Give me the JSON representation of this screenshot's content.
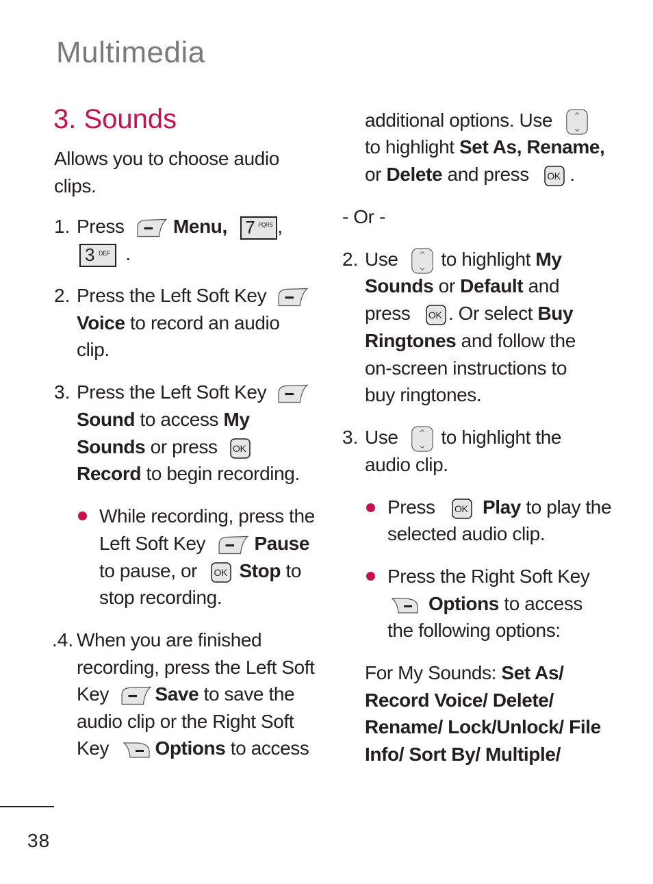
{
  "header": {
    "chapter_title": "Multimedia",
    "section_title": "3. Sounds"
  },
  "intro": [
    "Allows you to choose audio",
    "clips."
  ],
  "left_column": {
    "step1": {
      "num": "1.",
      "press": "Press",
      "menu": "Menu,",
      "comma": ",",
      "period": "."
    },
    "step2": {
      "num": "2.",
      "l1": "Press the Left Soft Key",
      "voice": "Voice",
      "l2rest": " to record an audio",
      "l3": "clip."
    },
    "step3": {
      "num": "3.",
      "l1": "Press the Left Soft Key",
      "sound": "Sound",
      "toaccess": " to access ",
      "my": "My",
      "sounds": "Sounds",
      "orpress": " or press",
      "record": "Record",
      "tobegin": " to begin recording."
    },
    "bullet1": {
      "l1": "While recording, press the",
      "l2a": "Left Soft Key",
      "pause": "Pause",
      "l3a": "to pause, or",
      "stop": "Stop",
      "l3b": " to",
      "l4": "stop recording."
    },
    "step4": {
      "num": ".4.",
      "l1": "When you are finished",
      "l2": "recording, press the Left Soft",
      "key": "Key",
      "save": "Save",
      "tosave": " to save the",
      "l4": "audio clip or the Right Soft",
      "options": "Options",
      "toaccess": " to access"
    }
  },
  "right_column": {
    "cont": {
      "l1": "additional options. Use",
      "l2a": "to highlight ",
      "l2b": "Set As, Rename,",
      "or": "or ",
      "delete": "Delete",
      "andpress": " and press",
      "period": "."
    },
    "or_sep": "- Or -",
    "step2": {
      "num": "2.",
      "use": "Use",
      "tohighlight": " to highlight ",
      "my": "My",
      "sounds": "Sounds",
      "or": " or ",
      "default": "Default",
      "and": " and",
      "press": "press",
      "orselect": ". Or select ",
      "buy": "Buy",
      "ringtones": "Ringtones",
      "follow": " and follow the",
      "l5": "on-screen instructions to",
      "l6": "buy ringtones."
    },
    "step3": {
      "num": "3.",
      "use": "Use",
      "tohighlight": " to highlight the",
      "l2": "audio clip."
    },
    "bullet1": {
      "press": "Press",
      "play": "Play",
      "toplay": " to play the",
      "l2": "selected audio clip."
    },
    "bullet2": {
      "l1": "Press the Right Soft Key",
      "options": "Options",
      "toaccess": " to access",
      "l3": "the following options:"
    },
    "mysounds": {
      "label": "For My Sounds: ",
      "l1b": "Set As/",
      "l2": "Record Voice/ Delete/",
      "l3": "Rename/ Lock/Unlock/ File",
      "l4": "Info/ Sort By/ Multiple/"
    }
  },
  "keys": {
    "ok": "OK",
    "seven": "7",
    "seven_sub": "PQRS",
    "three": "3",
    "three_sub": "DEF"
  },
  "footer": {
    "page_number": "38"
  },
  "colors": {
    "accent": "#c8104c",
    "chapter_gray": "#7a7a7a",
    "text": "#231f20",
    "key_fill": "#e6e6e6"
  }
}
